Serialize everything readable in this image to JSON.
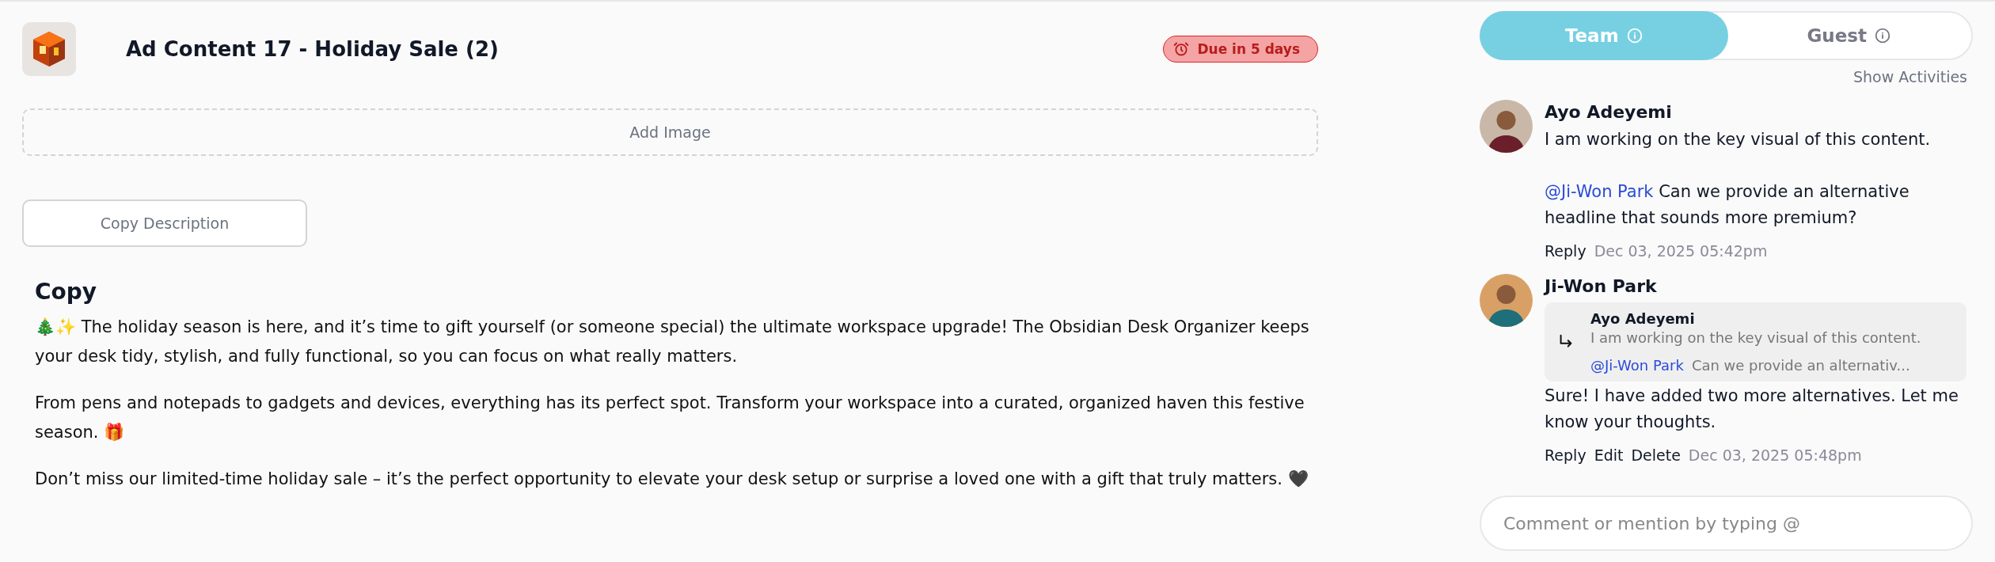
{
  "header": {
    "title": "Ad Content 17 - Holiday Sale (2)",
    "due_badge": "Due in 5 days"
  },
  "add_image": "Add Image",
  "copy_description_button": "Copy Description",
  "copy": {
    "heading": "Copy",
    "paragraphs": [
      "🎄✨ The holiday season is here, and it’s time to gift yourself (or someone special) the ultimate workspace upgrade! The Obsidian Desk Organizer keeps your desk tidy, stylish, and fully functional, so you can focus on what really matters.",
      "From pens and notepads to gadgets and devices, everything has its perfect spot. Transform your workspace into a curated, organized haven this festive season. 🎁",
      "Don’t miss our limited-time holiday sale – it’s the perfect opportunity to elevate your desk setup or surprise a loved one with a gift that truly matters. 🖤"
    ]
  },
  "tabs": [
    {
      "label": "Team",
      "selected": true
    },
    {
      "label": "Guest",
      "selected": false
    }
  ],
  "show_activities": "Show Activities",
  "comments": [
    {
      "author": "Ayo Adeyemi",
      "paragraphs": [
        {
          "text": "I am working on the key visual of this content."
        },
        {
          "mention": "@Ji-Won Park",
          "text": "Can we provide an alternative headline that sounds more premium?"
        }
      ],
      "actions": [
        "Reply"
      ],
      "time": "Dec 03, 2025 05:42pm"
    },
    {
      "author": "Ji-Won Park",
      "quote": {
        "author": "Ayo Adeyemi",
        "text": "I am working on the key visual of this content.",
        "mention": "@Ji-Won Park",
        "mention_text": "Can we provide an alternativ..."
      },
      "paragraphs": [
        {
          "text": "Sure! I have added two more alternatives. Let me know your thoughts."
        }
      ],
      "actions": [
        "Reply",
        "Edit",
        "Delete"
      ],
      "time": "Dec 03, 2025 05:48pm"
    }
  ],
  "comment_input": {
    "placeholder": "Comment or mention by typing @"
  }
}
